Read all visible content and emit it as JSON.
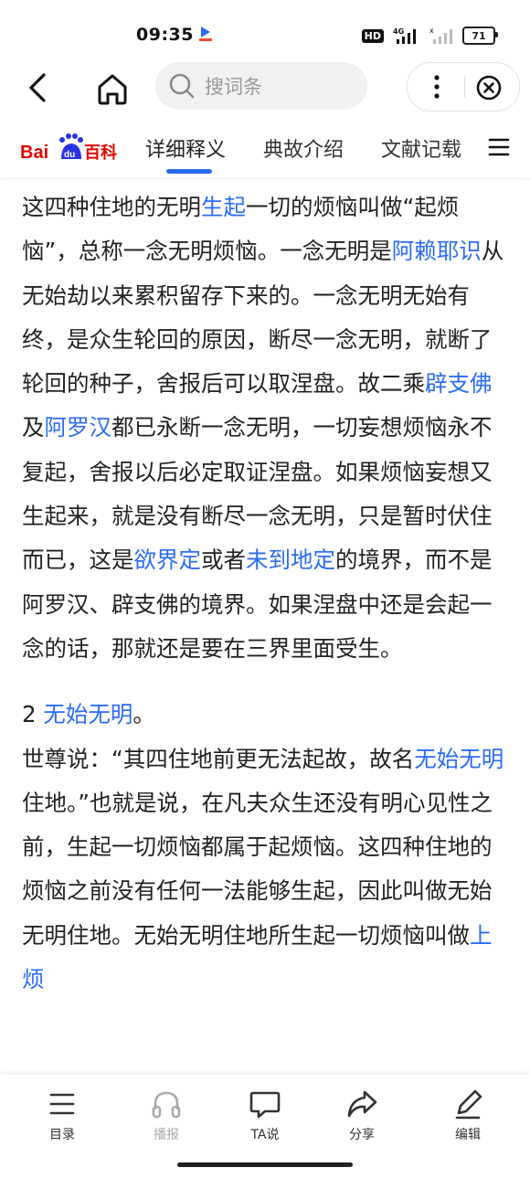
{
  "status": {
    "time": "09:35",
    "hd": "HD",
    "network": "4G",
    "battery": "71"
  },
  "search": {
    "placeholder": "搜词条"
  },
  "logo": {
    "part1": "Bai",
    "part2": "du",
    "part3": "百科"
  },
  "tabs": [
    {
      "label": "详细释义",
      "active": true
    },
    {
      "label": "典故介绍"
    },
    {
      "label": "文献记载"
    }
  ],
  "content": {
    "p1": [
      {
        "t": "这四种住地的无明"
      },
      {
        "t": "生起",
        "link": true
      },
      {
        "t": "一切的烦恼叫做“起烦恼”，总称一念无明烦恼。一念无明是"
      },
      {
        "t": "阿赖耶识",
        "link": true
      },
      {
        "t": "从无始劫以来累积留存下来的。一念无明无始有终，是众生轮回的原因，断尽一念无明，就断了轮回的种子，舍报后可以取涅盘。故二乘"
      },
      {
        "t": "辟支佛",
        "link": true
      },
      {
        "t": "及"
      },
      {
        "t": "阿罗汉",
        "link": true
      },
      {
        "t": "都已永断一念无明，一切妄想烦恼永不复起，舍报以后必定取证涅盘。如果烦恼妄想又生起来，就是没有断尽一念无明，只是暂时伏住而已，这是"
      },
      {
        "t": "欲界定",
        "link": true
      },
      {
        "t": "或者"
      },
      {
        "t": "未到地定",
        "link": true
      },
      {
        "t": "的境界，而不是阿罗汉、辟支佛的境界。如果涅盘中还是会起一念的话，那就还是要在三界里面受生。"
      }
    ],
    "section": [
      {
        "t": "2 "
      },
      {
        "t": "无始无明",
        "link": true
      },
      {
        "t": "。"
      }
    ],
    "p2": [
      {
        "t": "世尊说：“其四住地前更无法起故，故名"
      },
      {
        "t": "无始无明",
        "link": true
      },
      {
        "t": "住地。”也就是说，在凡夫众生还没有明心见性之前，生起一切烦恼都属于起烦恼。这四种住地的烦恼之前没有任何一法能够生起，因此叫做无始无明住地。无始无明住地所生起一切烦恼叫做"
      },
      {
        "t": "上烦",
        "link": true
      }
    ]
  },
  "bottom": {
    "catalog": "目录",
    "broadcast": "播报",
    "ta": "TA说",
    "share": "分享",
    "edit": "编辑"
  },
  "colors": {
    "link": "#2b6cf6",
    "logo_red": "#e10602",
    "logo_blue": "#2932e1"
  }
}
